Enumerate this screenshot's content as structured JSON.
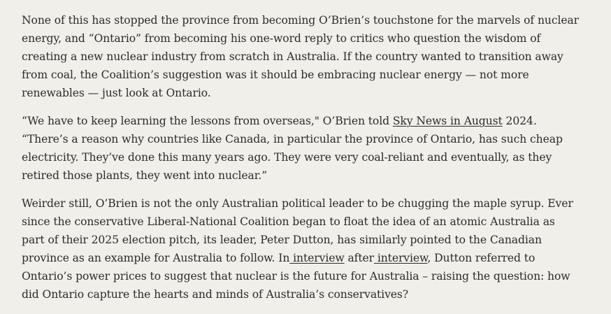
{
  "article": {
    "p1": "None of this has stopped the province from becoming O’Brien’s touchstone for the marvels of nuclear energy, and “Ontario” from becoming his one-word reply to critics who question the wisdom of creating a new nuclear industry from scratch in Australia. If the country wanted to transition away from coal, the Coalition’s suggestion was it should be embracing nuclear energy — not more renewables — just look at Ontario.",
    "p2": {
      "before": "“We have to keep learning the lessons from overseas,\" O’Brien told ",
      "link": "Sky News in August",
      "after": " 2024. “There’s a reason why countries like Canada, in particular the province of Ontario, has such cheap electricity. They’ve done this many years ago. They were very coal-reliant and eventually, as they retired those plants, they went into nuclear.”"
    },
    "p3": {
      "before": "Weirder still, O’Brien is not the only Australian political leader to be chugging the maple syrup. Ever since the conservative Liberal-National Coalition began to float the idea of an atomic Australia as part of their 2025 election pitch, its leader, Peter Dutton, has similarly pointed to the Canadian province as an example for Australia to follow. In",
      "link1": " interview",
      "middle": " after",
      "link2": " interview",
      "after": ", Dutton referred to Ontario’s power prices to suggest that nuclear is the future for Australia – raising the question: how did Ontario capture the hearts and minds of Australia’s conservatives?"
    }
  }
}
